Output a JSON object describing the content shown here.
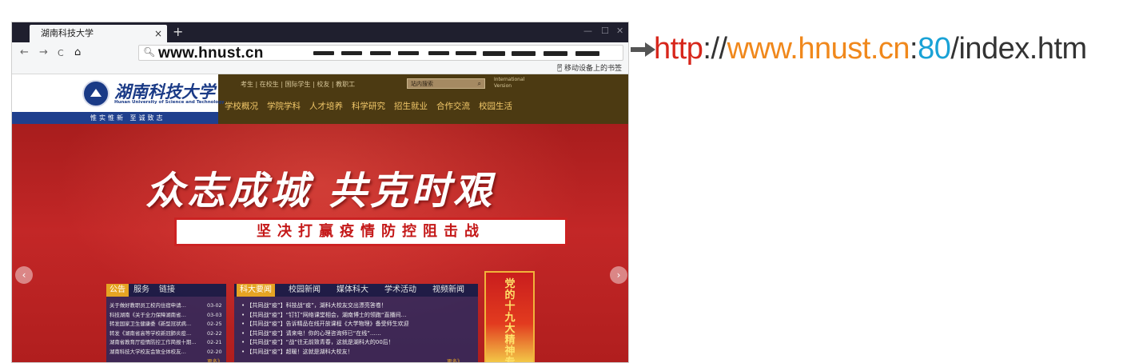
{
  "browser": {
    "tab_title": "湖南科技大学",
    "tab_close": "×",
    "new_tab": "+",
    "window_controls": [
      "—",
      "☐",
      "✕"
    ],
    "nav_back": "←",
    "nav_forward": "→",
    "nav_reload": "C",
    "nav_home": "⌂",
    "address": "www.hnust.cn",
    "bookmarks_label": "移动设备上的书签"
  },
  "site": {
    "logo_cn": "湖南科技大学",
    "logo_en": "Hunan University of Science and Technology",
    "motto": "惟实惟新 至诚致志",
    "top_links": "考生 | 在校生 | 国际学生 | 校友 | 教职工",
    "search_placeholder": "站内搜索",
    "search_icon": "search-icon",
    "intl_line1": "International",
    "intl_line2": "Version",
    "main_nav": [
      "学校概况",
      "学院学科",
      "人才培养",
      "科学研究",
      "招生就业",
      "合作交流",
      "校园生活"
    ],
    "banner_title": "众志成城 共克时艰",
    "banner_subtitle": "坚决打赢疫情防控阻击战",
    "slide_prev": "‹",
    "slide_next": "›",
    "notice_tabs": [
      "公告",
      "服务",
      "链接"
    ],
    "notices": [
      {
        "title": "关于做好教职员工校内住宿申请…",
        "date": "03-02"
      },
      {
        "title": "科技湖南《关于全力保障湖南省…",
        "date": "03-03"
      },
      {
        "title": "转发国家卫生健康委《新型冠状病…",
        "date": "02-25"
      },
      {
        "title": "转发《湖南省高等学校新冠肺炎疫…",
        "date": "02-22"
      },
      {
        "title": "湖南省教育厅疫情防控工作简报十期…",
        "date": "02-21"
      },
      {
        "title": "湖南科技大学校友会致全体校友…",
        "date": "02-20"
      }
    ],
    "more_label": "更多》",
    "news_tabs": [
      "科大要闻",
      "校园新闻",
      "媒体科大",
      "学术活动",
      "视频新闻"
    ],
    "news": [
      "【共同战“疫”】科技战“疫”，湖科大校友交出漂亮答卷！",
      "【共同战“疫”】“钉钉”网络课堂相会，湖南博士的领跑“直播间…",
      "【共同战“疫”】告诉精品在线开放课程《大学物理》备受师生欢迎",
      "【共同战“疫”】请来电！你的心理咨询师已“在线”……",
      "【共同战“疫”】“战”往无前致青春，这就是湖科大的00后！",
      "【共同战“疫”】超暖！这就是湖科大校友！"
    ],
    "party_banner": "党的十九大精神专题"
  },
  "annotation": {
    "parts": [
      {
        "text": "http",
        "color": "#d7261b"
      },
      {
        "text": "://",
        "color": "#333333"
      },
      {
        "text": "www.hnust.cn",
        "color": "#f0881c"
      },
      {
        "text": ":",
        "color": "#333333"
      },
      {
        "text": "80",
        "color": "#19a2d6"
      },
      {
        "text": "/",
        "color": "#333333"
      },
      {
        "text": "index.htm",
        "color": "#333333"
      }
    ]
  }
}
